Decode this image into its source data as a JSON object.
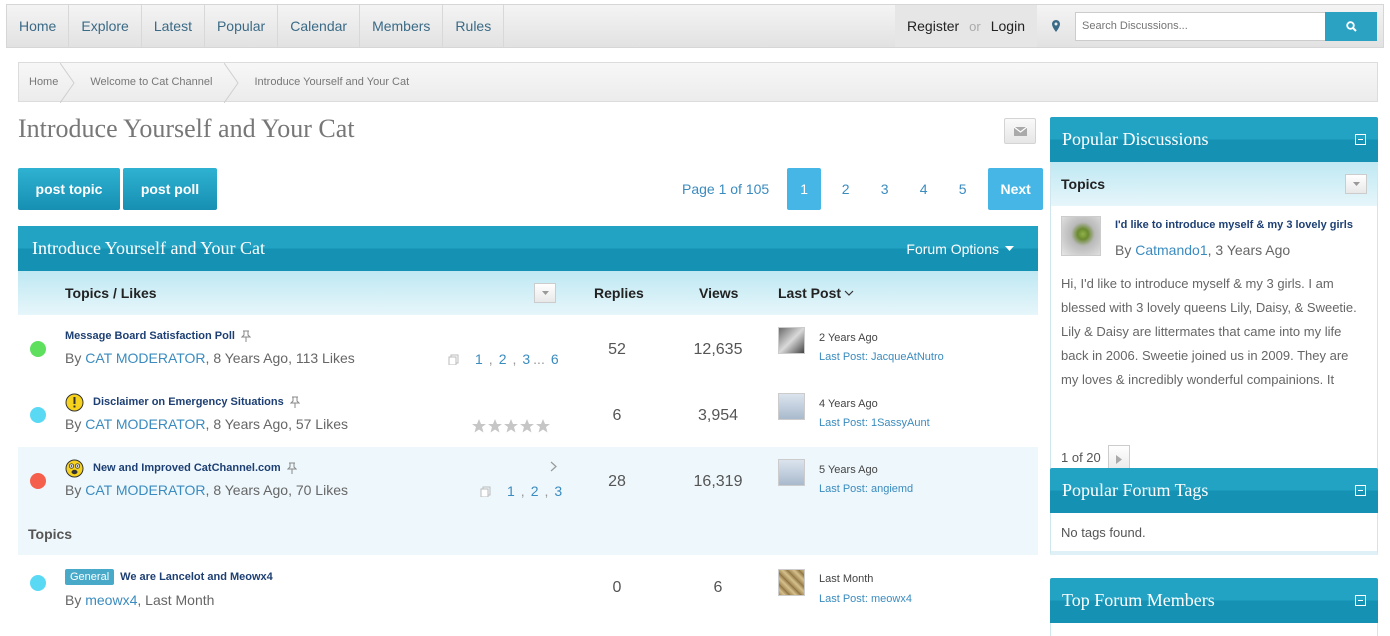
{
  "nav": {
    "items": [
      "Home",
      "Explore",
      "Latest",
      "Popular",
      "Calendar",
      "Members",
      "Rules"
    ],
    "register": "Register",
    "or": "or",
    "login": "Login",
    "search_placeholder": "Search Discussions..."
  },
  "breadcrumb": [
    "Home",
    "Welcome to Cat Channel",
    "Introduce Yourself and Your Cat"
  ],
  "page_title": "Introduce Yourself and Your Cat",
  "actions": {
    "post_topic": "post topic",
    "post_poll": "post poll"
  },
  "pager": {
    "label": "Page 1 of 105",
    "pages": [
      "1",
      "2",
      "3",
      "4",
      "5"
    ],
    "next": "Next"
  },
  "forum": {
    "title": "Introduce Yourself and Your Cat",
    "options": "Forum Options",
    "columns": {
      "topics": "Topics / Likes",
      "replies": "Replies",
      "views": "Views",
      "last_post": "Last Post"
    },
    "sticky_rows": [
      {
        "status_color": "#5ee05e",
        "title": "Message Board Satisfaction Poll",
        "by": "By",
        "author": "CAT MODERATOR",
        "meta": ", 8 Years Ago, 113 Likes",
        "pages": [
          "1",
          ",",
          "2",
          ",",
          "3",
          "...",
          "6"
        ],
        "replies": "52",
        "views": "12,635",
        "last_time": "2 Years Ago",
        "last_user": "Last Post: JacqueAtNutro"
      },
      {
        "status_color": "#5ad9f5",
        "title": "Disclaimer on Emergency Situations",
        "by": "By",
        "author": "CAT MODERATOR",
        "meta": ", 8 Years Ago, 57 Likes",
        "replies": "6",
        "views": "3,954",
        "last_time": "4 Years Ago",
        "last_user": "Last Post: 1SassyAunt"
      },
      {
        "status_color": "#f5604c",
        "title": "New and Improved CatChannel.com",
        "by": "By",
        "author": "CAT MODERATOR",
        "meta": ", 8 Years Ago, 70 Likes",
        "pages": [
          "1",
          ",",
          "2",
          ",",
          "3"
        ],
        "replies": "28",
        "views": "16,319",
        "last_time": "5 Years Ago",
        "last_user": "Last Post: angiemd"
      }
    ],
    "section_label": "Topics",
    "topic_rows": [
      {
        "status_color": "#5ad9f5",
        "tag": "General",
        "title": "We are Lancelot and Meowx4",
        "by": "By",
        "author": "meowx4",
        "meta": ", Last Month",
        "replies": "0",
        "views": "6",
        "last_time": "Last Month",
        "last_user": "Last Post: meowx4"
      }
    ]
  },
  "sidebar": {
    "popular": {
      "title": "Popular Discussions",
      "subhead": "Topics",
      "item_title": "I'd like to introduce myself & my 3 lovely girls",
      "item_by": "By",
      "item_author": "Catmando1",
      "item_meta": ", 3 Years Ago",
      "excerpt": "Hi, I'd like to introduce myself & my 3 girls. I am blessed with 3 lovely queens Lily, Daisy, & Sweetie. Lily & Daisy are littermates that came into my life back in 2006. Sweetie joined us in 2009. They are my loves & incredibly wonderful compainions. It",
      "pager": "1 of 20"
    },
    "tags": {
      "title": "Popular Forum Tags",
      "empty": "No tags found."
    },
    "members": {
      "title": "Top Forum Members"
    }
  },
  "colors": {
    "accent": "#1d9ec0",
    "link": "#3a8bbf",
    "title_link": "#1d3f73"
  }
}
